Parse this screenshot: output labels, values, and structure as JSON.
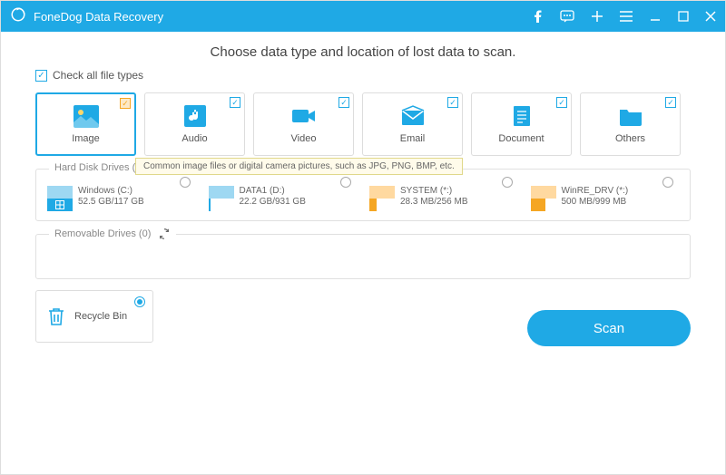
{
  "titlebar": {
    "title": "FoneDog Data Recovery"
  },
  "heading": "Choose data type and location of lost data to scan.",
  "checkall_label": "Check all file types",
  "types": [
    {
      "label": "Image",
      "selected": true
    },
    {
      "label": "Audio"
    },
    {
      "label": "Video"
    },
    {
      "label": "Email"
    },
    {
      "label": "Document"
    },
    {
      "label": "Others"
    }
  ],
  "tooltip": "Common image files or digital camera pictures, such as JPG, PNG, BMP, etc.",
  "hdd_title": "Hard Disk Drives (4)",
  "drives": [
    {
      "name": "Windows (C:)",
      "size": "52.5 GB/117 GB"
    },
    {
      "name": "DATA1 (D:)",
      "size": "22.2 GB/931 GB"
    },
    {
      "name": "SYSTEM (*:)",
      "size": "28.3 MB/256 MB"
    },
    {
      "name": "WinRE_DRV (*:)",
      "size": "500 MB/999 MB"
    }
  ],
  "removable_title": "Removable Drives (0)",
  "recycle_label": "Recycle Bin",
  "scan_label": "Scan"
}
